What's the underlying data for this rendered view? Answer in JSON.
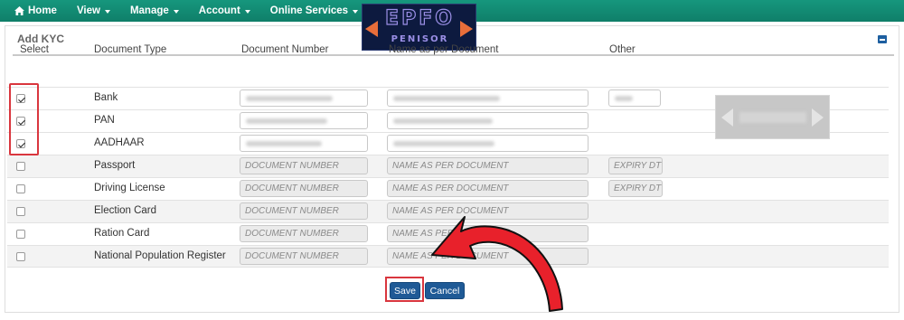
{
  "nav": {
    "home": "Home",
    "view": "View",
    "manage": "Manage",
    "account": "Account",
    "online_services": "Online Services"
  },
  "logo": {
    "line1": "EPFO",
    "line2": "PENISOR"
  },
  "panel": {
    "title": "Add KYC"
  },
  "table": {
    "headers": {
      "select": "Select",
      "document_type": "Document Type",
      "document_number": "Document Number",
      "name": "Name as per Document",
      "other": "Other"
    },
    "rows": [
      {
        "label": "Bank",
        "checked": true
      },
      {
        "label": "PAN",
        "checked": true
      },
      {
        "label": "AADHAAR",
        "checked": true
      },
      {
        "label": "Passport",
        "checked": false,
        "num_placeholder": "DOCUMENT NUMBER",
        "name_placeholder": "NAME AS PER DOCUMENT",
        "other_placeholder": "EXPIRY DT"
      },
      {
        "label": "Driving License",
        "checked": false,
        "num_placeholder": "DOCUMENT NUMBER",
        "name_placeholder": "NAME AS PER DOCUMENT",
        "other_placeholder": "EXPIRY DT"
      },
      {
        "label": "Election Card",
        "checked": false,
        "num_placeholder": "DOCUMENT NUMBER",
        "name_placeholder": "NAME AS PER DOCUMENT"
      },
      {
        "label": "Ration Card",
        "checked": false,
        "num_placeholder": "DOCUMENT NUMBER",
        "name_placeholder": "NAME AS PER DOCUMENT"
      },
      {
        "label": "National Population Register",
        "checked": false,
        "num_placeholder": "DOCUMENT NUMBER",
        "name_placeholder": "NAME AS PER DOCUMENT"
      }
    ]
  },
  "buttons": {
    "save": "Save",
    "cancel": "Cancel"
  },
  "colors": {
    "navbar": "#138d75",
    "button": "#1f5a96",
    "highlight": "#d9363e",
    "arrow": "#e8212b"
  }
}
